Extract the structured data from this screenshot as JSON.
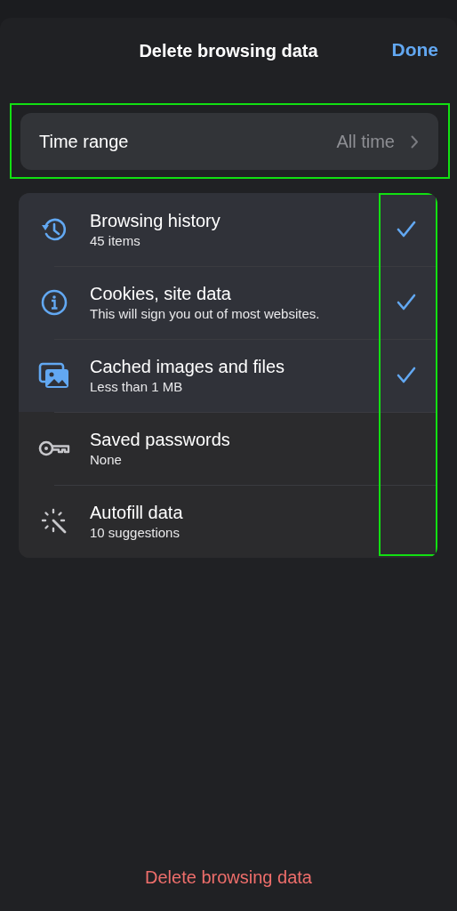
{
  "header": {
    "title": "Delete browsing data",
    "done_button": "Done"
  },
  "time_range": {
    "label": "Time range",
    "value": "All time",
    "highlighted": true
  },
  "data_types": {
    "checkmarks_highlighted": true,
    "items": [
      {
        "kind": "history",
        "title": "Browsing history",
        "detail": "45 items",
        "checked": true
      },
      {
        "kind": "info",
        "title": "Cookies, site data",
        "detail": "This will sign you out of most websites.",
        "checked": true
      },
      {
        "kind": "images",
        "title": "Cached images and files",
        "detail": "Less than 1 MB",
        "checked": true
      },
      {
        "kind": "key",
        "title": "Saved passwords",
        "detail": "None",
        "checked": false
      },
      {
        "kind": "sparkle",
        "title": "Autofill data",
        "detail": "10 suggestions",
        "checked": false
      }
    ]
  },
  "footer": {
    "delete_button": "Delete browsing data"
  }
}
